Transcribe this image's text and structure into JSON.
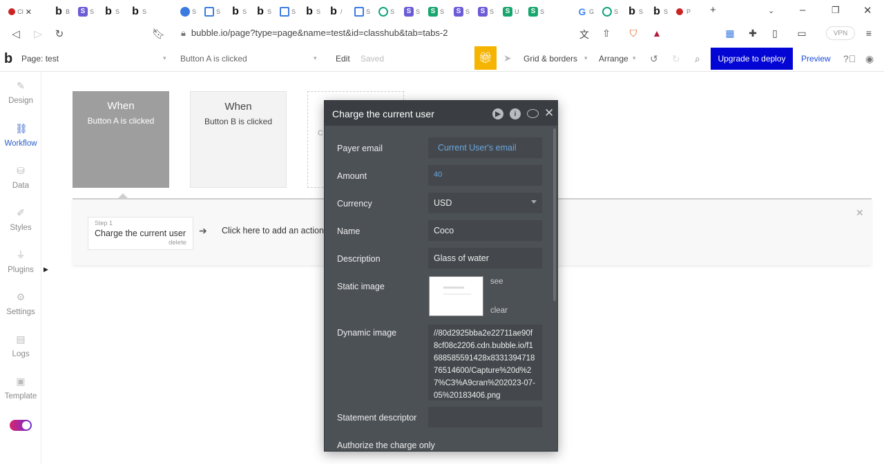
{
  "browser": {
    "tabs": [
      {
        "icon": "red-dot",
        "text": "Cl"
      },
      {
        "icon": "b",
        "text": "B"
      },
      {
        "icon": "s",
        "text": "S"
      },
      {
        "icon": "b",
        "text": "S"
      },
      {
        "icon": "b",
        "text": "S"
      },
      {
        "icon": "blue-circle",
        "text": "S"
      },
      {
        "icon": "table",
        "text": "S"
      },
      {
        "icon": "b",
        "text": "S"
      },
      {
        "icon": "b",
        "text": "S"
      },
      {
        "icon": "table",
        "text": "S"
      },
      {
        "icon": "b",
        "text": "S"
      },
      {
        "icon": "b",
        "text": "/"
      },
      {
        "icon": "table",
        "text": "S"
      },
      {
        "icon": "gpt",
        "text": "S"
      },
      {
        "icon": "s",
        "text": "S"
      },
      {
        "icon": "g",
        "text": "S"
      },
      {
        "icon": "s",
        "text": "S"
      },
      {
        "icon": "s",
        "text": "S"
      },
      {
        "icon": "g",
        "text": "U"
      },
      {
        "icon": "g",
        "text": "S"
      },
      {
        "icon": "google",
        "text": "G"
      },
      {
        "icon": "gpt",
        "text": "S"
      },
      {
        "icon": "b",
        "text": "S"
      },
      {
        "icon": "b",
        "text": "S"
      },
      {
        "icon": "red-dot",
        "text": "P"
      }
    ],
    "url": "bubble.io/page?type=page&name=test&id=classhub&tab=tabs-2",
    "vpn_label": "VPN"
  },
  "toolbar": {
    "page_label": "Page: test",
    "workflow_label": "Button A is clicked",
    "edit_label": "Edit",
    "saved_label": "Saved",
    "grid_label": "Grid & borders",
    "arrange_label": "Arrange",
    "upgrade_label": "Upgrade to deploy",
    "preview_label": "Preview"
  },
  "sidebar": {
    "items": [
      {
        "label": "Design",
        "icon": "design-icon"
      },
      {
        "label": "Workflow",
        "icon": "workflow-icon"
      },
      {
        "label": "Data",
        "icon": "data-icon"
      },
      {
        "label": "Styles",
        "icon": "styles-icon"
      },
      {
        "label": "Plugins",
        "icon": "plugins-icon"
      },
      {
        "label": "Settings",
        "icon": "settings-icon"
      },
      {
        "label": "Logs",
        "icon": "logs-icon"
      },
      {
        "label": "Template",
        "icon": "template-icon"
      }
    ]
  },
  "workflow": {
    "events": [
      {
        "title": "When",
        "subtitle": "Button A is clicked"
      },
      {
        "title": "When",
        "subtitle": "Button B is clicked"
      }
    ],
    "add_event_partial": "C",
    "step": {
      "number": "Step 1",
      "title": "Charge the current user",
      "delete": "delete"
    },
    "add_action": "Click here to add an action"
  },
  "editor": {
    "title": "Charge the current user",
    "fields": {
      "payer_email": {
        "label": "Payer email",
        "value": "Current User's email"
      },
      "amount": {
        "label": "Amount",
        "value": "40"
      },
      "currency": {
        "label": "Currency",
        "value": "USD"
      },
      "name": {
        "label": "Name",
        "value": "Coco"
      },
      "description": {
        "label": "Description",
        "value": "Glass of water"
      },
      "static_image": {
        "label": "Static image",
        "see": "see",
        "clear": "clear"
      },
      "dynamic_image": {
        "label": "Dynamic image",
        "value": "//80d2925bba2e22711ae90f8cf08c2206.cdn.bubble.io/f1688585591428x833139471876514600/Capture%20d%27%C3%A9cran%202023-07-05%20183406.png"
      },
      "statement_descriptor": {
        "label": "Statement descriptor",
        "value": ""
      },
      "authorize_only": {
        "label": "Authorize the charge only"
      }
    }
  },
  "colors": {
    "upgrade_bg": "#0205d3",
    "gift_bg": "#f5b400",
    "editor_bg": "#4c5156",
    "dynamic_text": "#6aa6e0",
    "active_sidebar": "#2b5cc9"
  }
}
